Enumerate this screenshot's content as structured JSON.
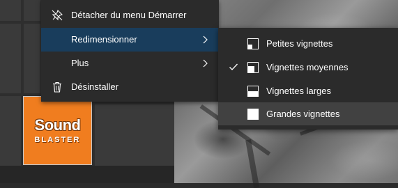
{
  "context_menu": {
    "items": [
      {
        "label": "Détacher du menu Démarrer",
        "icon": "unpin-icon"
      },
      {
        "label": "Redimensionner",
        "has_submenu": true
      },
      {
        "label": "Plus",
        "has_submenu": true
      },
      {
        "label": "Désinstaller",
        "icon": "trash-icon"
      }
    ]
  },
  "resize_submenu": {
    "items": [
      {
        "label": "Petites vignettes",
        "icon": "small-tile-icon",
        "checked": false
      },
      {
        "label": "Vignettes moyennes",
        "icon": "medium-tile-icon",
        "checked": true
      },
      {
        "label": "Vignettes larges",
        "icon": "wide-tile-icon",
        "checked": false
      },
      {
        "label": "Grandes vignettes",
        "icon": "large-tile-icon",
        "checked": false
      }
    ]
  },
  "tile": {
    "logo_word_top": "Sound",
    "logo_word_bottom": "BLASTER",
    "accent_color": "#f07d1f"
  },
  "colors": {
    "menu_bg": "#2b2b2b",
    "highlight": "#193d5c",
    "hover": "#414141",
    "text": "#ffffff"
  }
}
